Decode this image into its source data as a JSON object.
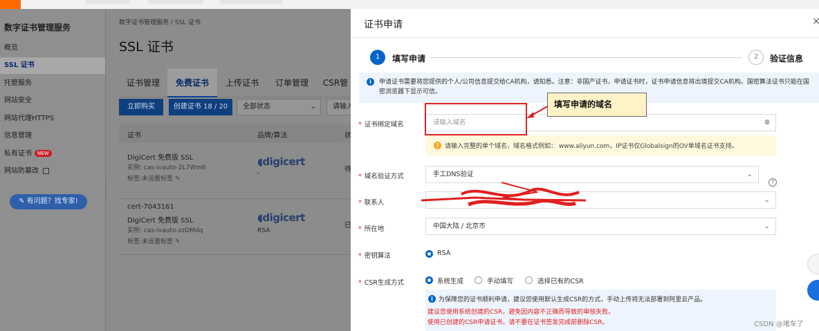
{
  "left_nav": {
    "title": "数字证书管理服务",
    "items": [
      "概览",
      "SSL 证书",
      "托管服务",
      "网站安全",
      "网站代理HTTPS",
      "信息管理",
      "私有证书",
      "网站防篡改"
    ],
    "new_badge": "NEW",
    "expert_button": "有问题？找专家!"
  },
  "main": {
    "breadcrumb": "数字证书管理服务  /  SSL 证书",
    "title": "SSL 证书",
    "tabs": [
      "证书管理",
      "免费证书",
      "上传证书",
      "订单管理",
      "CSR管"
    ],
    "buy_button": "立即购买",
    "create_button": "创建证书 18 / 20",
    "status_select": "全部状态",
    "search_placeholder": "请输入",
    "table_headers": [
      "证书",
      "品牌/算法",
      "状"
    ],
    "rows": [
      {
        "name": "DigiCert 免费版 SSL",
        "instance": "实例: cas-ivauto-2L7Wm6",
        "tag": "标签:未设置标签",
        "brand": "digicert",
        "algo": "-",
        "status": "待"
      },
      {
        "id": "cert-7043161",
        "name": "DigiCert 免费版 SSL",
        "instance": "实例: cas-ivauto-zzDMdq",
        "tag": "标签:未设置标签",
        "brand": "digicert",
        "algo": "RSA",
        "status": "已"
      }
    ]
  },
  "drawer": {
    "title": "证书申请",
    "steps": [
      {
        "num": "1",
        "label": "填写申请"
      },
      {
        "num": "2",
        "label": "验证信息"
      }
    ],
    "notice": "申请证书需要将您提供的个人/公司信息提交给CA机构，请知悉。注意：非国产证书，申请证书时，证书申请信息将出境提交CA机构。国密算法证书只能在国密浏览器下显示可信。",
    "domain_label": "证书绑定域名",
    "domain_placeholder": "请输入域名",
    "domain_warning": "请输入完整的单个域名，域名格式例如： www.aliyun.com，IP证书仅Globalsign的OV单域名证书支持。",
    "verify_label": "域名验证方式",
    "verify_value": "手工DNS验证",
    "contact_label": "联系人",
    "region_label": "所在地",
    "region_value": "中国大陆 / 北京市",
    "algo_label": "密钥算法",
    "algo_value": "RSA",
    "csr_label": "CSR生成方式",
    "csr_options": [
      "系统生成",
      "手动填写",
      "选择已有的CSR"
    ],
    "csr_note_1": "为保障您的证书顺利申请，建议您使用默认生成CSR的方式，手动上传将无法部署到阿里云产品。",
    "csr_note_2": "建议您使用系统创建的CSR，避免因内容不正确而导致的审核失败。",
    "csr_note_3": "使用已创建的CSR申请证书，请不要在证书签发完成前删除CSR。"
  },
  "annotation": {
    "callout_text": "填写申请的域名",
    "callout_color": "#fef3c6",
    "highlight_color": "#e02020"
  },
  "watermark": "CSDN @堵车了"
}
